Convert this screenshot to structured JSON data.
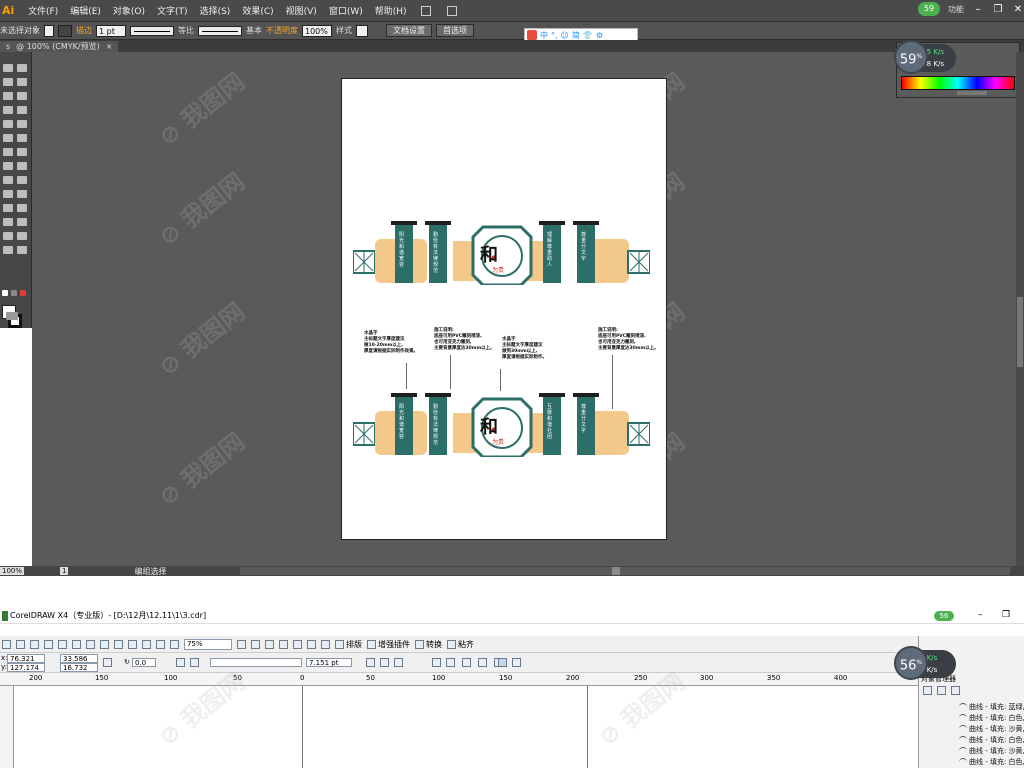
{
  "ai": {
    "logo": "Ai",
    "menu": [
      "文件(F)",
      "编辑(E)",
      "对象(O)",
      "文字(T)",
      "选择(S)",
      "效果(C)",
      "视图(V)",
      "窗口(W)",
      "帮助(H)"
    ],
    "top_right_badge": "59",
    "top_right_label": "功能",
    "control": {
      "selection": "未选择对象",
      "stroke_label": "描边",
      "stroke_weight": "1 pt",
      "profile1": "等比",
      "profile2": "基本",
      "opacity_label": "不透明度",
      "opacity_value": "100%",
      "style_label": "样式",
      "doc_setup": "文档设置",
      "prefs": "首选项"
    },
    "ime": [
      "中",
      "°,",
      "☺",
      "简"
    ],
    "tab": {
      "left": "s",
      "title": "@ 100% (CMYK/预览)",
      "close": "×"
    },
    "status": {
      "zoom": "100%",
      "page": "1",
      "tool": "编组选择"
    },
    "gauge": {
      "value": "59",
      "unit": "%",
      "up": "3.5",
      "up_unit": "K/s",
      "down": "0.8",
      "down_unit": "K/s"
    }
  },
  "artboard": {
    "annotations": [
      {
        "text": "水晶字\n主标题文字厚度建议\n做10-20mm以上,\n厚度请根据实际制作效果。"
      },
      {
        "text": "施工说明:\n底座可用PVC雕刻喷漆,\n也可用亚克力雕刻,\n主要背景厚度达30mm以上。"
      },
      {
        "text": "水晶字\n主标题文字厚度建议\n做到30mm以上,\n厚度请根据实际制作。"
      },
      {
        "text": "施工说明:\n底座可用PVC雕刻喷漆,\n也可用亚克力雕刻,\n主要背景厚度达30mm以上。"
      }
    ],
    "center_char": "和",
    "center_sub": "为贵",
    "panels": [
      "阳光和谐宽容",
      "勤俭有法律规范",
      "理解尊重助人",
      "互敬和谐社团",
      "尊重分文字"
    ]
  },
  "cdr": {
    "title": "CorelDRAW X4（专业版）- [D:\\12月\\12.11\\1\\3.cdr]",
    "badge": "56",
    "zoom": "75%",
    "buttons": [
      "排版",
      "增强插件",
      "转换",
      "粘齐"
    ],
    "x": "76.321 mm",
    "y": "127.174 mm",
    "w": "33.586 mm",
    "h": "16.732 mm",
    "angle": "0.0",
    "font_size": "7.151 pt",
    "ruler_ticks": [
      "200",
      "150",
      "100",
      "50",
      "0",
      "50",
      "100",
      "150",
      "200",
      "250",
      "300",
      "350",
      "400"
    ],
    "gauge": {
      "value": "56",
      "unit": "%",
      "up": "0",
      "up_unit": "K/s",
      "down": "0",
      "down_unit": "K/s"
    },
    "docker": {
      "title": "对象管理器",
      "items": [
        "曲线 - 填充: 蓝绿, 轮",
        "曲线 - 填充: 白色, 轮",
        "曲线 - 填充: 沙黄, 轮",
        "曲线 - 填充: 白色, 轮",
        "曲线 - 填充: 沙黄, 轮",
        "曲线 - 填充: 白色, 轮"
      ]
    }
  },
  "colors": {
    "teal": "#2c6e68",
    "sand": "#f3c98b",
    "dark": "#1f1f1f",
    "red": "#d62d1f"
  }
}
